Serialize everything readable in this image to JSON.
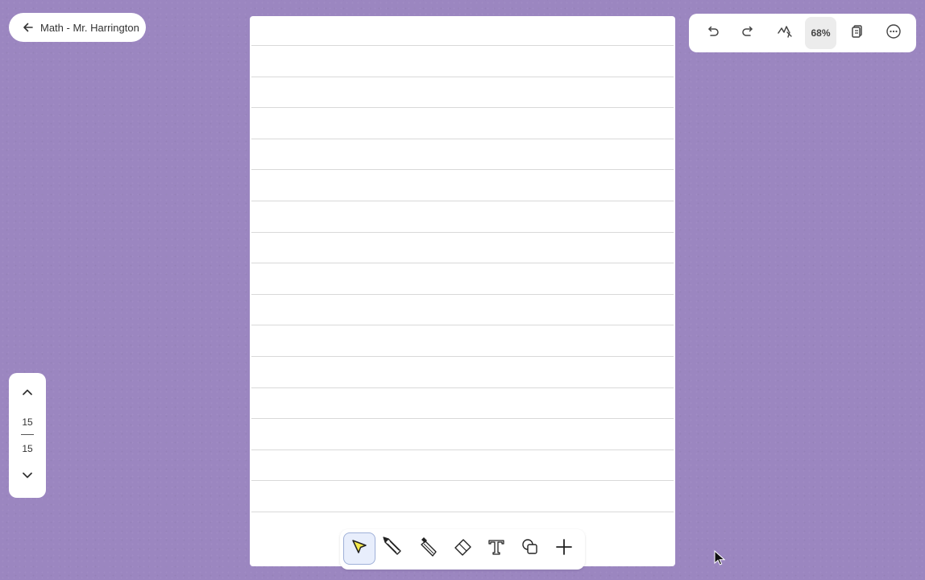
{
  "header": {
    "back_label": "Math - Mr. Harrington"
  },
  "toolbar": {
    "zoom_label": "68%",
    "buttons": [
      "undo-icon",
      "redo-icon",
      "lasso-icon",
      "zoom",
      "pages-icon",
      "more-icon"
    ]
  },
  "page_nav": {
    "current": "15",
    "total": "15"
  },
  "tools": [
    {
      "name": "select-tool",
      "icon": "cursor-pointer-icon",
      "active": true
    },
    {
      "name": "pen-tool",
      "icon": "pen-icon",
      "active": false
    },
    {
      "name": "highlighter-tool",
      "icon": "highlighter-icon",
      "active": false
    },
    {
      "name": "eraser-tool",
      "icon": "eraser-icon",
      "active": false
    },
    {
      "name": "text-tool",
      "icon": "text-icon",
      "active": false
    },
    {
      "name": "shapes-tool",
      "icon": "shapes-icon",
      "active": false
    },
    {
      "name": "add-tool",
      "icon": "plus-icon",
      "active": false
    }
  ],
  "colors": {
    "background": "#9b86c0",
    "active_tool_bg": "#e8eefc",
    "select_fill": "#f5e94a"
  }
}
